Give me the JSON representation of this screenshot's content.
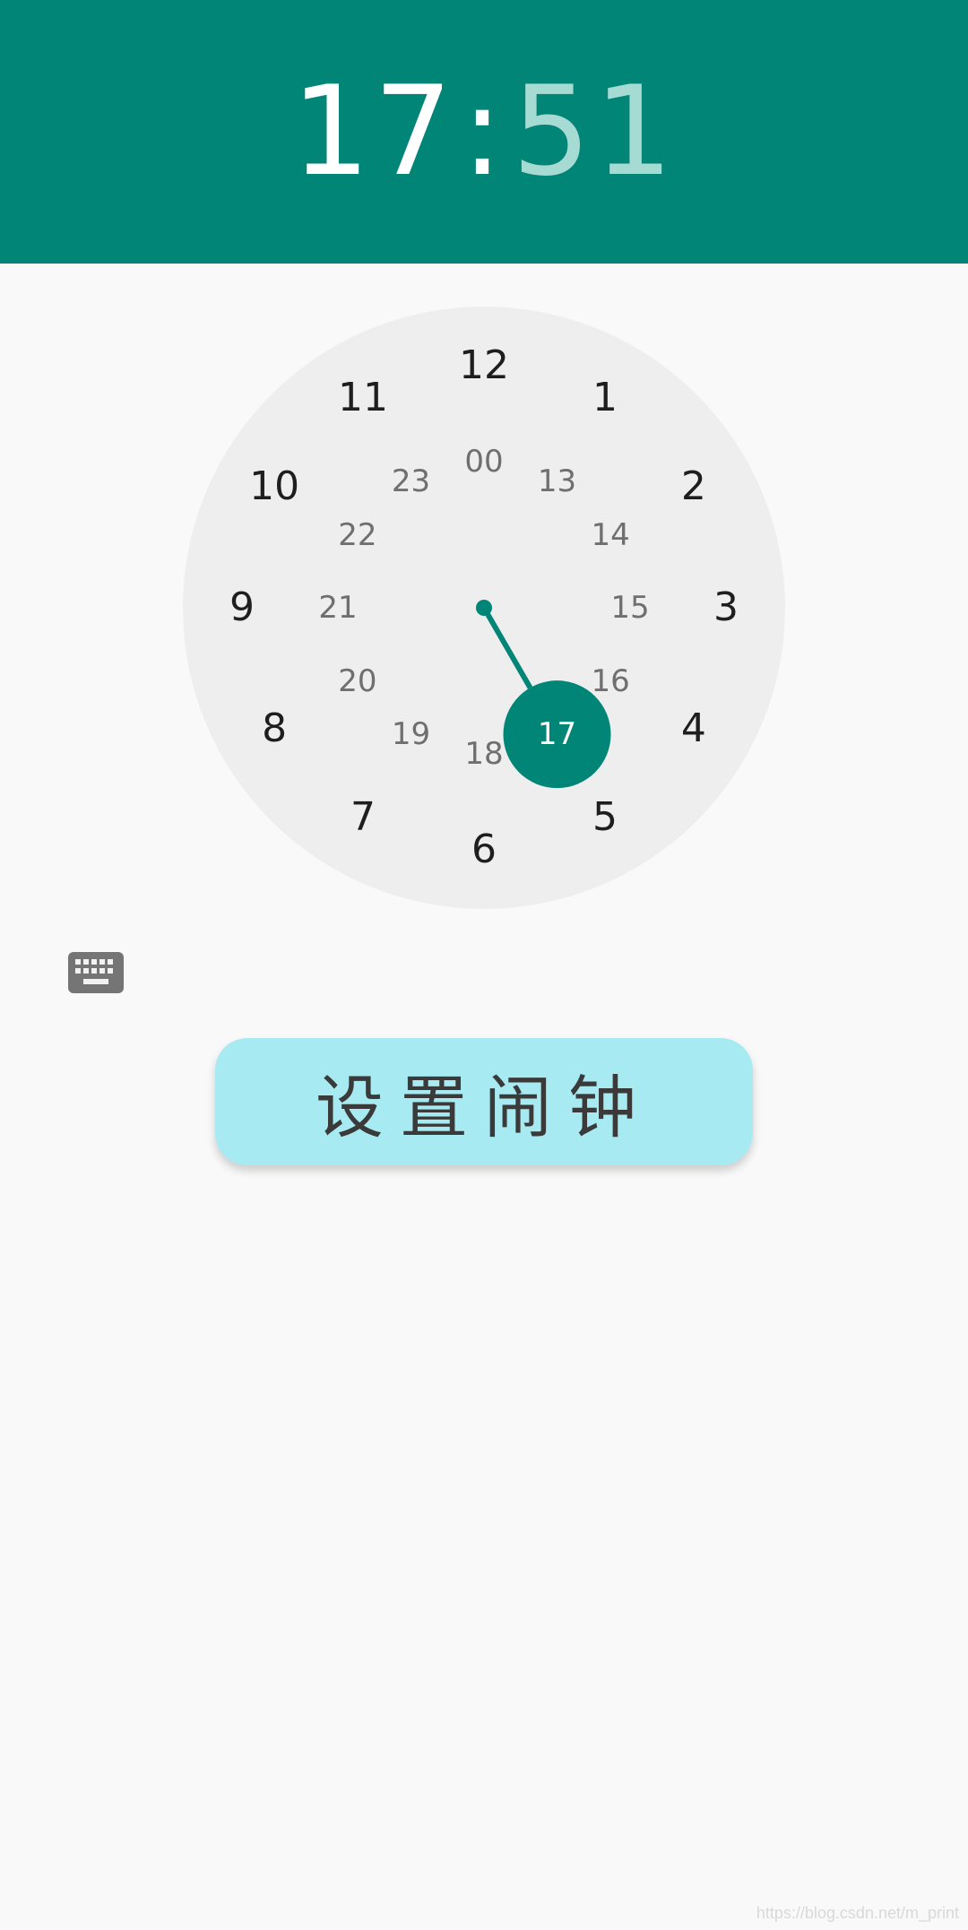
{
  "header": {
    "hour": "17",
    "separator": ":",
    "minute": "51",
    "background": "#018577",
    "minute_color": "#a6dbd3"
  },
  "clock": {
    "outer_numbers": [
      "12",
      "1",
      "2",
      "3",
      "4",
      "5",
      "6",
      "7",
      "8",
      "9",
      "10",
      "11"
    ],
    "inner_numbers": [
      "00",
      "13",
      "14",
      "15",
      "16",
      "17",
      "18",
      "19",
      "20",
      "21",
      "22",
      "23"
    ],
    "selected": "17",
    "accent": "#018577",
    "face_color": "#eeeeee"
  },
  "keyboard_toggle": {
    "icon": "keyboard-icon"
  },
  "button": {
    "label": "设置闹钟",
    "color": "#a8eaf2"
  },
  "watermark": "https://blog.csdn.net/m_print"
}
